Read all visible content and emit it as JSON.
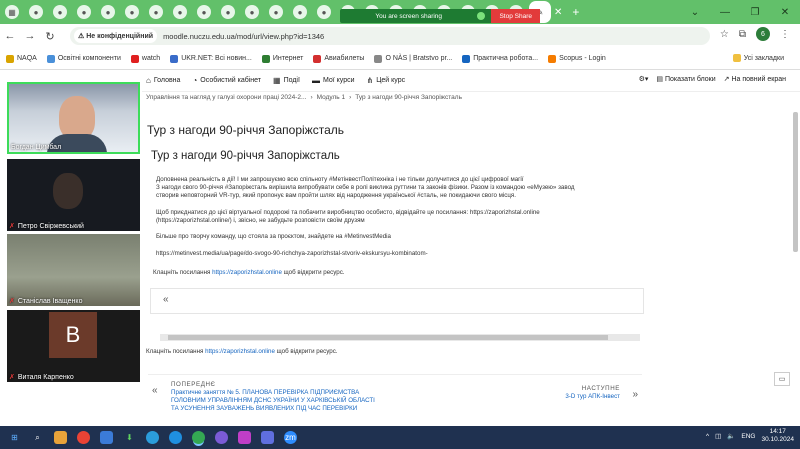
{
  "browser": {
    "tab_count_visible": 20,
    "not_secure_label": "Не конфіденційний",
    "url": "moodle.nuczu.edu.ua/mod/url/view.php?id=1346",
    "share_text": "You are screen sharing",
    "stop_share_label": "Stop Share",
    "profile_initial": "6",
    "colors": {
      "chrome": "#62c06a",
      "share_bar": "#1e7b32",
      "stop": "#e23b3b"
    }
  },
  "bookmarks": {
    "items": [
      "NAQA",
      "Освітні компоненти",
      "watch",
      "UKR.NET: Всі новин...",
      "Интернет",
      "Авиабилеты",
      "О NÀS | Bratstvo pr...",
      "Практична робота...",
      "Scopus - Login"
    ],
    "all_label": "Усі закладки"
  },
  "participants": [
    {
      "name": "Богдан Цимбал"
    },
    {
      "name": "Петро Свіржевський"
    },
    {
      "name": "Станіслав Іващенко"
    },
    {
      "name": "Виталя Карпенко",
      "initial": "B"
    }
  ],
  "moodle": {
    "nav": [
      "Головна",
      "Особистий кабінет",
      "Події",
      "Мої курси",
      "Цей курс"
    ],
    "show_blocks": "Показати блоки",
    "fullscreen": "На повний екран",
    "breadcrumb": [
      "Управління та нагляд у галузі охорони праці 2024-2...",
      "Модуль 1",
      "Тур з нагоди 90-річчя Запоріжсталь"
    ],
    "page_title": "Тур з нагоди 90-річчя Запоріжсталь",
    "inner_title": "Тур з нагоди 90-річчя Запоріжсталь",
    "para1_line1": "Доповнена реальність в дії! І ми запрошуємо всю спільноту #МетінвестПолітехніка і не тільки  долучитися до цієї цифрової магії",
    "para1_line2": "З нагоди свого 90-річчя #Запоріжсталь вирішила випробувати себе в ролі виклика руттини та законів фізики. Разом із командою «еМузею» завод",
    "para1_line3": "створив неповторний VR-тур, який пропонує вам пройти шлях від народження української #сталь, не покидаючи свого місця.",
    "para2_line1": "Щоб приєднатися до цієї віртуальної подорожі та побачити виробництво особисто, відвідайте це посилання: https://zaporizhstal.online",
    "para2_line2": "(https://zaporizhstal.online/) і, звісно, не забудьте розповісти своїм друзям",
    "para3": "Більше про творчу команду, що стояла за проєктом, знайдете на #MetinvestMedia",
    "link_media": "https://metinvest.media/ua/page/do-svogo-90-richchya-zaporizhstal-stvoriv-ekskursyu-kombinatom-",
    "click_prefix": "Клацніть посилання",
    "click_link": "https://zaporizhstal.online",
    "click_suffix": "щоб відкрити ресурс.",
    "prev_label": "ПОПЕРЕДНЄ",
    "prev_line1": "Практичне заняття № 5. ПЛАНОВА ПЕРЕВІРКА ПІДПРИЄМСТВА",
    "prev_line2": "ГОЛОВНИМ УПРАВЛІННЯМ  ДСНС УКРАЇНИ У ХАРКІВСЬКІЙ ОБЛАСТІ",
    "prev_line3": "ТА УСУНЕННЯ ЗАУВАЖЕНЬ  ВИЯВЛЕНИХ ПІД ЧАС ПЕРЕВІРКИ",
    "next_label": "НАСТУПНЕ",
    "next_title": "3-D тур  АПК-Інвест",
    "arrow_left": "«",
    "prev_arrow": "‹",
    "next_arrow": "›"
  },
  "taskbar": {
    "lang": "ENG",
    "time": "14:17",
    "date": "30.10.2024"
  }
}
